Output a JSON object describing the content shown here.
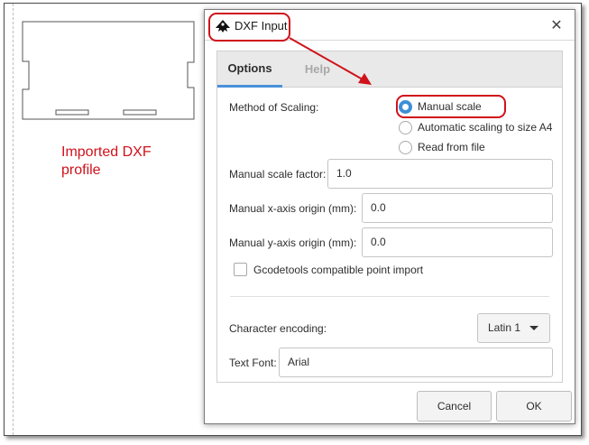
{
  "annotation": {
    "text": "Imported DXF\nprofile",
    "color": "#d0121b"
  },
  "dialog": {
    "title": "DXF Input",
    "close_glyph": "✕",
    "tabs": [
      {
        "label": "Options",
        "active": true
      },
      {
        "label": "Help",
        "active": false
      }
    ],
    "scaling": {
      "label": "Method of Scaling:",
      "options": [
        {
          "label": "Manual scale",
          "selected": true
        },
        {
          "label": "Automatic scaling to size A4",
          "selected": false
        },
        {
          "label": "Read from file",
          "selected": false
        }
      ]
    },
    "scale_factor": {
      "label": "Manual scale factor:",
      "value": "1.0"
    },
    "x_origin": {
      "label": "Manual x-axis origin (mm):",
      "value": "0.0"
    },
    "y_origin": {
      "label": "Manual y-axis origin (mm):",
      "value": "0.0"
    },
    "gcodetools": {
      "label": "Gcodetools compatible point import",
      "checked": false
    },
    "encoding": {
      "label": "Character encoding:",
      "value": "Latin 1"
    },
    "text_font": {
      "label": "Text Font:",
      "value": "Arial"
    },
    "buttons": {
      "cancel": "Cancel",
      "ok": "OK"
    }
  },
  "colors": {
    "accent": "#3d8fd8",
    "highlight": "#d0121b"
  },
  "icons": {
    "title": "inkscape-icon",
    "close": "close-icon",
    "dropdown": "chevron-down-icon"
  }
}
